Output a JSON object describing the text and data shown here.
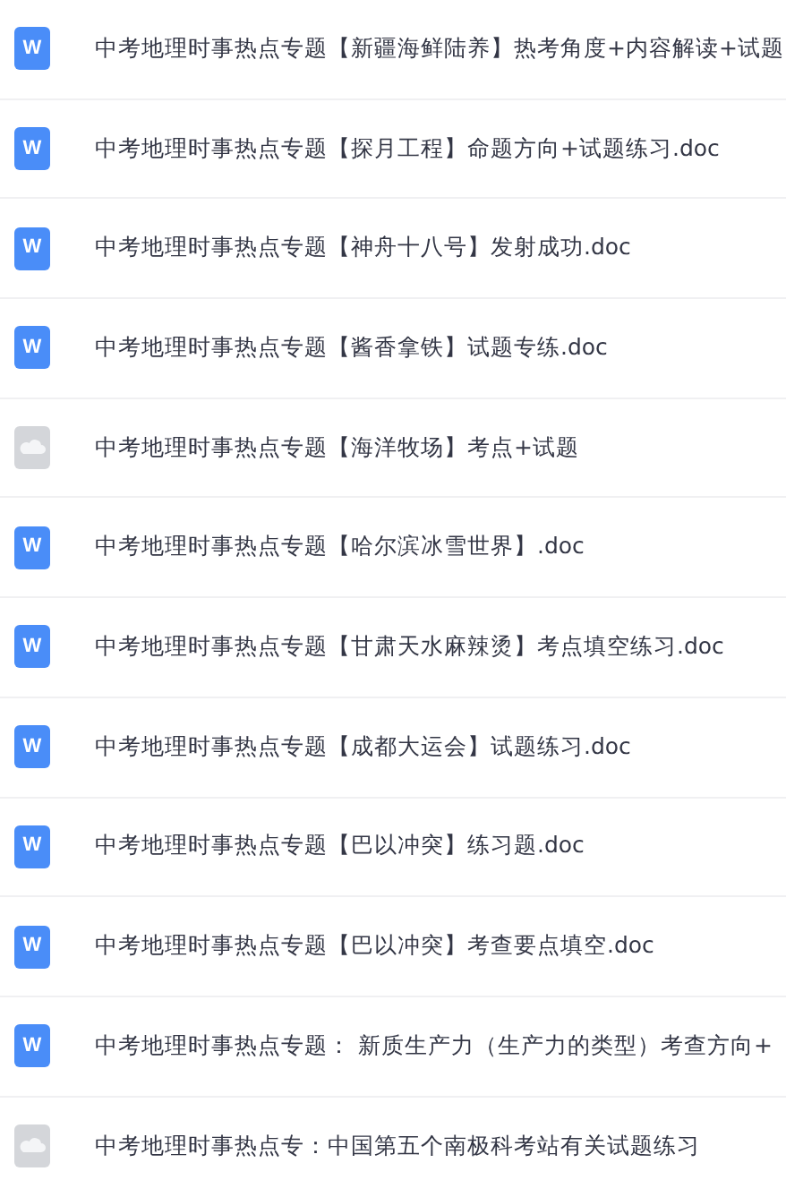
{
  "files": [
    {
      "kind": "word",
      "icon_letter": "W",
      "name": "中考地理时事热点专题【新疆海鲜陆养】热考角度+内容解读+试题"
    },
    {
      "kind": "word",
      "icon_letter": "W",
      "name": "中考地理时事热点专题【探月工程】命题方向+试题练习.doc"
    },
    {
      "kind": "word",
      "icon_letter": "W",
      "name": "中考地理时事热点专题【神舟十八号】发射成功.doc"
    },
    {
      "kind": "word",
      "icon_letter": "W",
      "name": "中考地理时事热点专题【酱香拿铁】试题专练.doc"
    },
    {
      "kind": "cloud",
      "name": "中考地理时事热点专题【海洋牧场】考点+试题"
    },
    {
      "kind": "word",
      "icon_letter": "W",
      "name": "中考地理时事热点专题【哈尔滨冰雪世界】.doc"
    },
    {
      "kind": "word",
      "icon_letter": "W",
      "name": "中考地理时事热点专题【甘肃天水麻辣烫】考点填空练习.doc"
    },
    {
      "kind": "word",
      "icon_letter": "W",
      "name": "中考地理时事热点专题【成都大运会】试题练习.doc"
    },
    {
      "kind": "word",
      "icon_letter": "W",
      "name": "中考地理时事热点专题【巴以冲突】练习题.doc"
    },
    {
      "kind": "word",
      "icon_letter": "W",
      "name": "中考地理时事热点专题【巴以冲突】考查要点填空.doc"
    },
    {
      "kind": "word",
      "icon_letter": "W",
      "name": "中考地理时事热点专题： 新质生产力（生产力的类型）考查方向+"
    },
    {
      "kind": "cloud",
      "name": "中考地理时事热点专：中国第五个南极科考站有关试题练习"
    }
  ]
}
